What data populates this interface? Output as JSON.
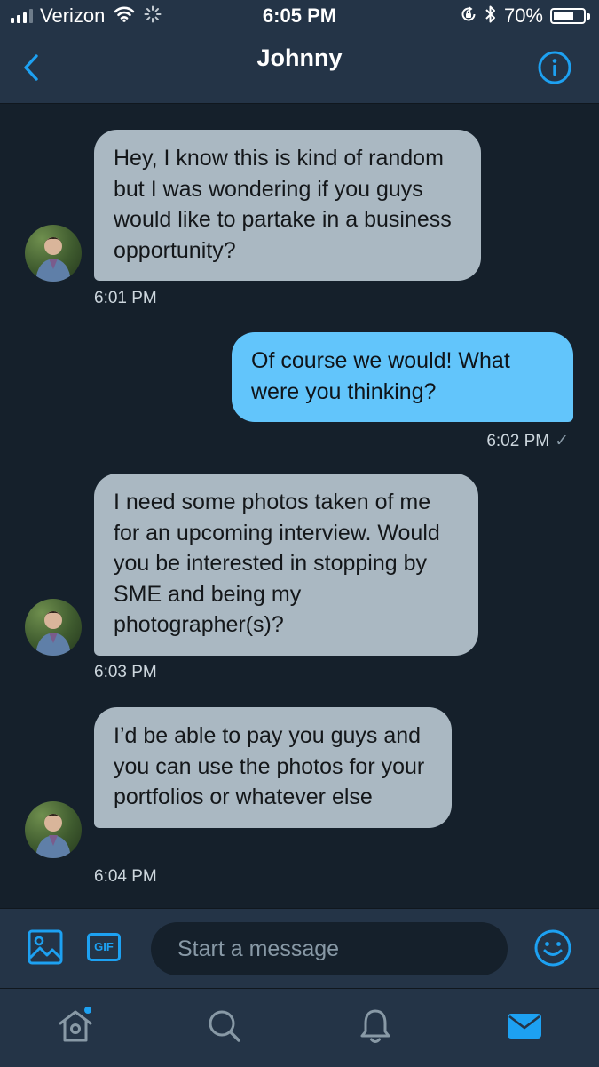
{
  "status_bar": {
    "carrier": "Verizon",
    "time": "6:05 PM",
    "battery": "70%",
    "battery_level": 0.7,
    "icons": [
      "signal-icon",
      "wifi-icon",
      "activity-spinner-icon",
      "rotation-lock-icon",
      "bluetooth-icon",
      "battery-icon"
    ]
  },
  "header": {
    "title": "Johnny",
    "back_icon": "chevron-left-icon",
    "info_icon": "info-icon"
  },
  "messages": [
    {
      "direction": "in",
      "text": "Hey, I know this is kind of random but I was wondering if you guys would like to partake in a business opportunity?",
      "time": "6:01 PM"
    },
    {
      "direction": "out",
      "text": "Of course we would! What were you thinking?",
      "time": "6:02 PM",
      "status": "✓"
    },
    {
      "direction": "in",
      "text": "I need some photos taken of me for an upcoming interview. Would you be interested in stopping by SME and being my photographer(s)?",
      "time": "6:03 PM"
    },
    {
      "direction": "in",
      "text": "I’d be able to pay you guys and you can use the photos for your portfolios or whatever else",
      "time": "6:04 PM"
    }
  ],
  "composer": {
    "gif_label": "GIF",
    "placeholder": "Start a message",
    "icons": [
      "image-icon",
      "gif-icon",
      "emoji-icon"
    ]
  },
  "tab_bar": {
    "tabs": [
      "home-icon",
      "search-icon",
      "notifications-icon",
      "messages-icon"
    ],
    "active": "messages-icon",
    "home_badge": true
  },
  "colors": {
    "background": "#15202b",
    "bar": "#243447",
    "accent": "#1da1f2",
    "incoming_bubble": "#aab8c2",
    "outgoing_bubble": "#62c5fb"
  }
}
